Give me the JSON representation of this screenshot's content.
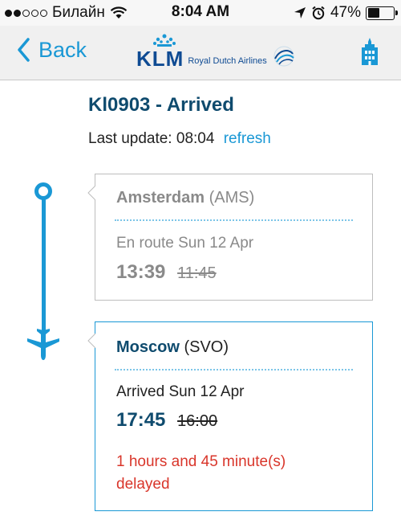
{
  "status_bar": {
    "carrier": "Билайн",
    "time": "8:04 AM",
    "battery": "47%",
    "battery_level": 0.47,
    "signal_bars_filled": 2,
    "signal_bars_total": 5
  },
  "nav": {
    "back_label": "Back",
    "brand": "KLM",
    "brand_subtitle": "Royal Dutch Airlines",
    "accent_color": "#1a98d5",
    "brand_color": "#0f4b93"
  },
  "flight": {
    "title": "Kl0903 - Arrived",
    "last_update_label": "Last update:",
    "last_update_time": "08:04",
    "refresh_label": "refresh"
  },
  "origin": {
    "city": "Amsterdam",
    "code": "(AMS)",
    "status": "En route Sun 12 Apr",
    "actual_time": "13:39",
    "scheduled_time": "11:45"
  },
  "destination": {
    "city": "Moscow",
    "code": "(SVO)",
    "status": "Arrived Sun 12 Apr",
    "actual_time": "17:45",
    "scheduled_time": "16:00",
    "delay_line1": "1 hours and 45 minute(s)",
    "delay_line2": "delayed",
    "delay_color": "#d9362b"
  }
}
